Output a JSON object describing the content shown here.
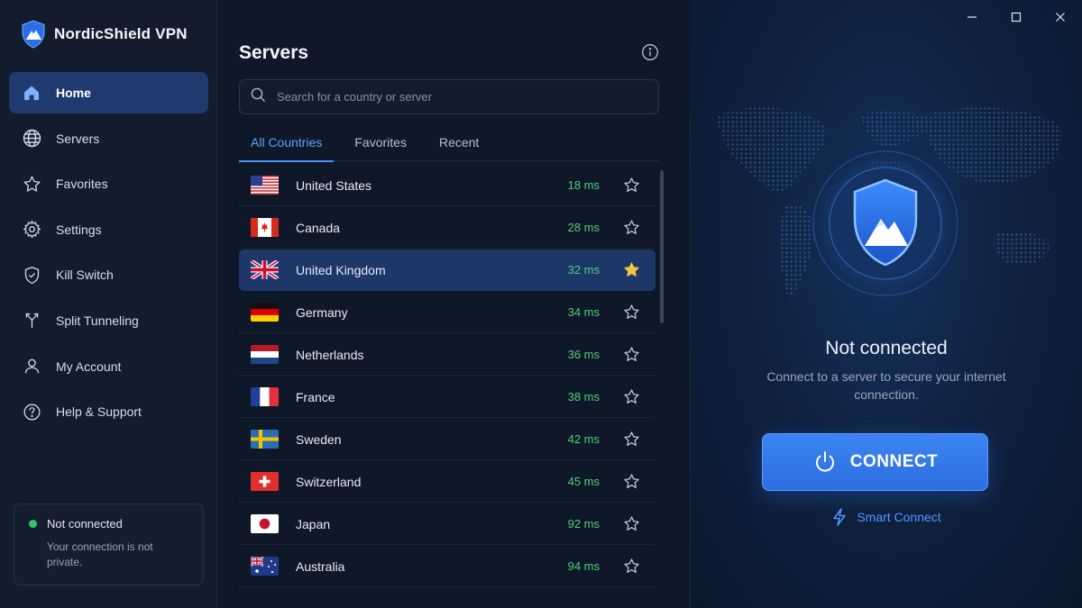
{
  "app": {
    "name": "NordicShield VPN"
  },
  "sidebar": {
    "items": [
      {
        "label": "Home",
        "icon": "home-icon",
        "active": true
      },
      {
        "label": "Servers",
        "icon": "globe-icon",
        "active": false
      },
      {
        "label": "Favorites",
        "icon": "star-icon",
        "active": false
      },
      {
        "label": "Settings",
        "icon": "gear-icon",
        "active": false
      },
      {
        "label": "Kill Switch",
        "icon": "shield-check-icon",
        "active": false
      },
      {
        "label": "Split Tunneling",
        "icon": "split-icon",
        "active": false
      },
      {
        "label": "My Account",
        "icon": "user-icon",
        "active": false
      },
      {
        "label": "Help & Support",
        "icon": "help-icon",
        "active": false
      }
    ],
    "status": {
      "title": "Not connected",
      "description": "Your connection is not private.",
      "dot_color": "#36c46a"
    }
  },
  "servers": {
    "title": "Servers",
    "search_placeholder": "Search for a country or server",
    "tabs": [
      {
        "label": "All Countries",
        "active": true
      },
      {
        "label": "Favorites",
        "active": false
      },
      {
        "label": "Recent",
        "active": false
      }
    ],
    "list": [
      {
        "country": "United States",
        "ping": "18 ms",
        "flag": "us",
        "favorite": false,
        "selected": false
      },
      {
        "country": "Canada",
        "ping": "28 ms",
        "flag": "ca",
        "favorite": false,
        "selected": false
      },
      {
        "country": "United Kingdom",
        "ping": "32 ms",
        "flag": "gb",
        "favorite": true,
        "selected": true
      },
      {
        "country": "Germany",
        "ping": "34 ms",
        "flag": "de",
        "favorite": false,
        "selected": false
      },
      {
        "country": "Netherlands",
        "ping": "36 ms",
        "flag": "nl",
        "favorite": false,
        "selected": false
      },
      {
        "country": "France",
        "ping": "38 ms",
        "flag": "fr",
        "favorite": false,
        "selected": false
      },
      {
        "country": "Sweden",
        "ping": "42 ms",
        "flag": "se",
        "favorite": false,
        "selected": false
      },
      {
        "country": "Switzerland",
        "ping": "45 ms",
        "flag": "ch",
        "favorite": false,
        "selected": false
      },
      {
        "country": "Japan",
        "ping": "92 ms",
        "flag": "jp",
        "favorite": false,
        "selected": false
      },
      {
        "country": "Australia",
        "ping": "94 ms",
        "flag": "au",
        "favorite": false,
        "selected": false
      }
    ]
  },
  "connection": {
    "status_title": "Not connected",
    "status_description": "Connect to a server to secure your internet connection.",
    "connect_label": "CONNECT",
    "smart_connect_label": "Smart Connect"
  },
  "colors": {
    "accent": "#3c84f2",
    "ping": "#4fcf76",
    "favorite_star": "#f5c542",
    "selected_row": "#1d3768"
  }
}
